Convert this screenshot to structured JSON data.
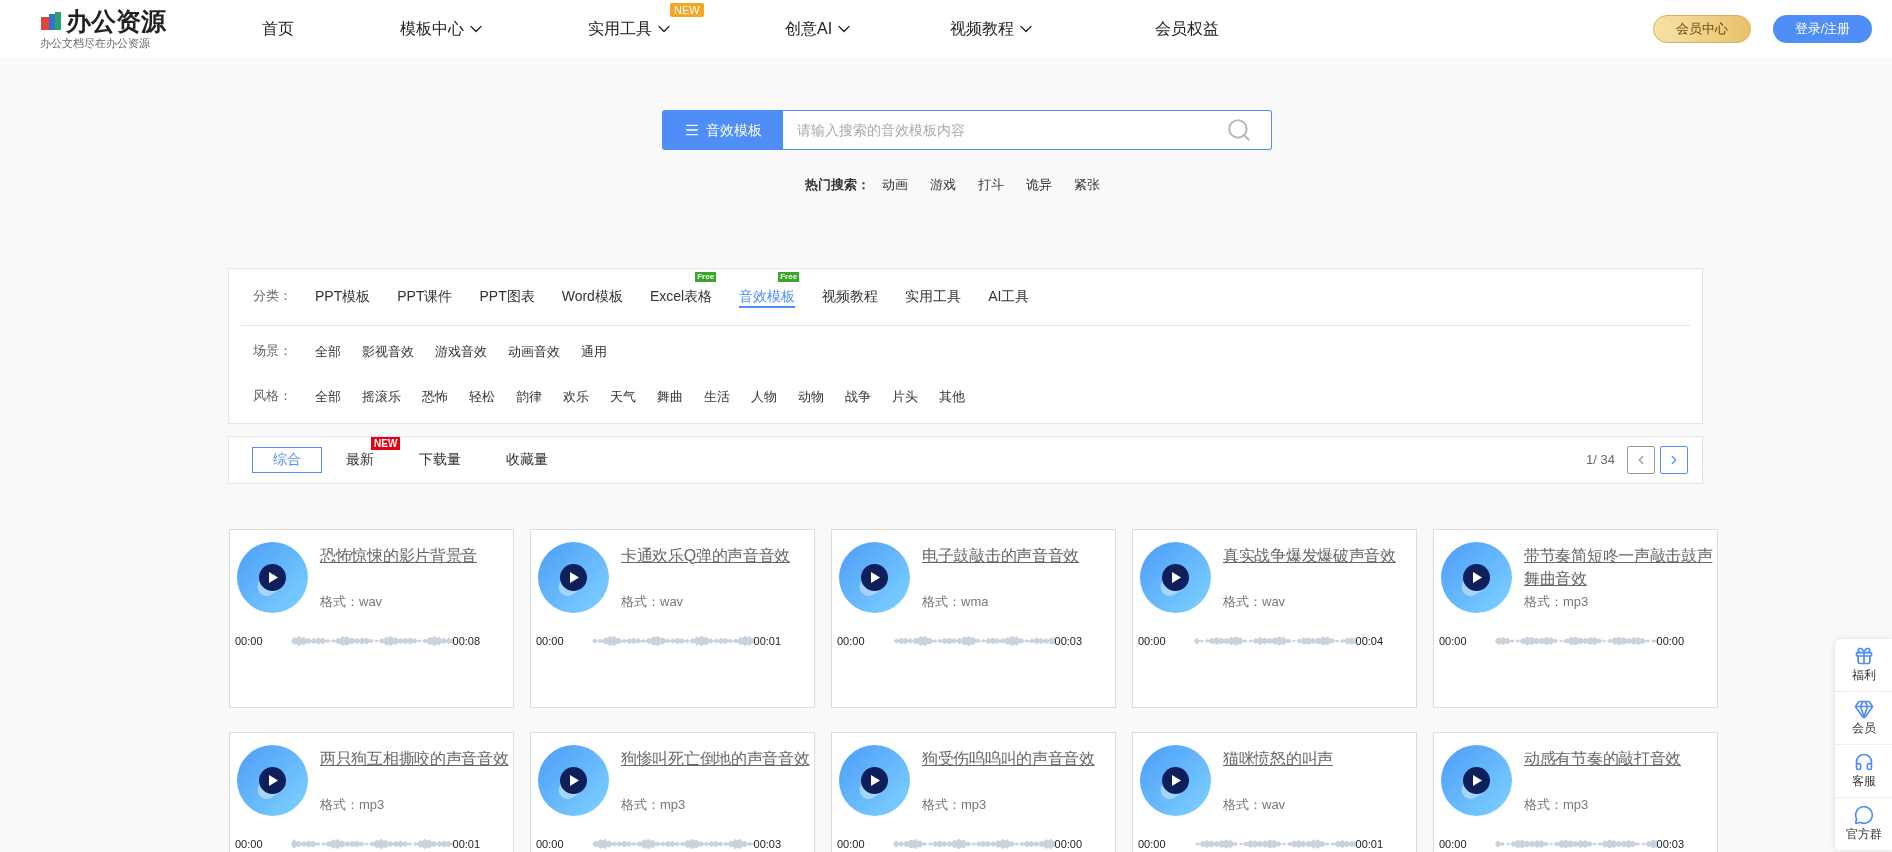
{
  "header": {
    "logo": {
      "name": "办公资源",
      "tagline": "办公文档尽在办公资源"
    },
    "nav": [
      {
        "label": "首页",
        "has_caret": false
      },
      {
        "label": "模板中心",
        "has_caret": true
      },
      {
        "label": "实用工具",
        "has_caret": true,
        "badge": "NEW"
      },
      {
        "label": "创意AI",
        "has_caret": true
      },
      {
        "label": "视频教程",
        "has_caret": true
      },
      {
        "label": "会员权益",
        "has_caret": false
      }
    ],
    "vip_button": "会员中心",
    "login_button": "登录/注册"
  },
  "search": {
    "category": "音效模板",
    "placeholder": "请输入搜索的音效模板内容",
    "hot_label": "热门搜索：",
    "hot_terms": [
      "动画",
      "游戏",
      "打斗",
      "诡异",
      "紧张"
    ]
  },
  "filters": [
    {
      "label": "分类：",
      "options": [
        {
          "label": "PPT模板",
          "selected": false
        },
        {
          "label": "PPT课件",
          "selected": false
        },
        {
          "label": "PPT图表",
          "selected": false
        },
        {
          "label": "Word模板",
          "selected": false
        },
        {
          "label": "Excel表格",
          "selected": false,
          "badge": "Free"
        },
        {
          "label": "音效模板",
          "selected": true,
          "badge": "Free"
        },
        {
          "label": "视频教程",
          "selected": false
        },
        {
          "label": "实用工具",
          "selected": false
        },
        {
          "label": "AI工具",
          "selected": false
        }
      ]
    },
    {
      "label": "场景：",
      "options": [
        {
          "label": "全部",
          "selected": false
        },
        {
          "label": "影视音效",
          "selected": false
        },
        {
          "label": "游戏音效",
          "selected": false
        },
        {
          "label": "动画音效",
          "selected": false
        },
        {
          "label": "通用",
          "selected": false
        }
      ]
    },
    {
      "label": "风格：",
      "options": [
        {
          "label": "全部",
          "selected": false
        },
        {
          "label": "摇滚乐",
          "selected": false
        },
        {
          "label": "恐怖",
          "selected": false
        },
        {
          "label": "轻松",
          "selected": false
        },
        {
          "label": "韵律",
          "selected": false
        },
        {
          "label": "欢乐",
          "selected": false
        },
        {
          "label": "天气",
          "selected": false
        },
        {
          "label": "舞曲",
          "selected": false
        },
        {
          "label": "生活",
          "selected": false
        },
        {
          "label": "人物",
          "selected": false
        },
        {
          "label": "动物",
          "selected": false
        },
        {
          "label": "战争",
          "selected": false
        },
        {
          "label": "片头",
          "selected": false
        },
        {
          "label": "其他",
          "selected": false
        }
      ]
    }
  ],
  "sort": {
    "options": [
      {
        "label": "综合",
        "selected": true
      },
      {
        "label": "最新",
        "selected": false,
        "badge": "NEW"
      },
      {
        "label": "下载量",
        "selected": false
      },
      {
        "label": "收藏量",
        "selected": false
      }
    ],
    "page": "1/ 34",
    "prev_disabled": true
  },
  "cards": [
    {
      "title": "恐怖惊悚的影片背景音",
      "format": "格式：wav",
      "start": "00:00",
      "end": "00:08"
    },
    {
      "title": "卡通欢乐Q弹的声音音效",
      "format": "格式：wav",
      "start": "00:00",
      "end": "00:01"
    },
    {
      "title": "电子鼓敲击的声音音效",
      "format": "格式：wma",
      "start": "00:00",
      "end": "00:03"
    },
    {
      "title": "真实战争爆发爆破声音效",
      "format": "格式：wav",
      "start": "00:00",
      "end": "00:04"
    },
    {
      "title": "带节奏简短咚一声敲击鼓声舞曲音效",
      "format": "格式：mp3",
      "start": "00:00",
      "end": "00:00"
    },
    {
      "title": "两只狗互相撕咬的声音音效",
      "format": "格式：mp3",
      "start": "00:00",
      "end": "00:01"
    },
    {
      "title": "狗惨叫死亡倒地的声音音效",
      "format": "格式：mp3",
      "start": "00:00",
      "end": "00:03"
    },
    {
      "title": "狗受伤呜呜叫的声音音效",
      "format": "格式：mp3",
      "start": "00:00",
      "end": "00:00"
    },
    {
      "title": "猫咪愤怒的叫声",
      "format": "格式：wav",
      "start": "00:00",
      "end": "00:01"
    },
    {
      "title": "动感有节奏的敲打音效",
      "format": "格式：mp3",
      "start": "00:00",
      "end": "00:03"
    }
  ],
  "side_panel": [
    {
      "label": "福利"
    },
    {
      "label": "会员"
    },
    {
      "label": "客服"
    },
    {
      "label": "官方群"
    }
  ]
}
